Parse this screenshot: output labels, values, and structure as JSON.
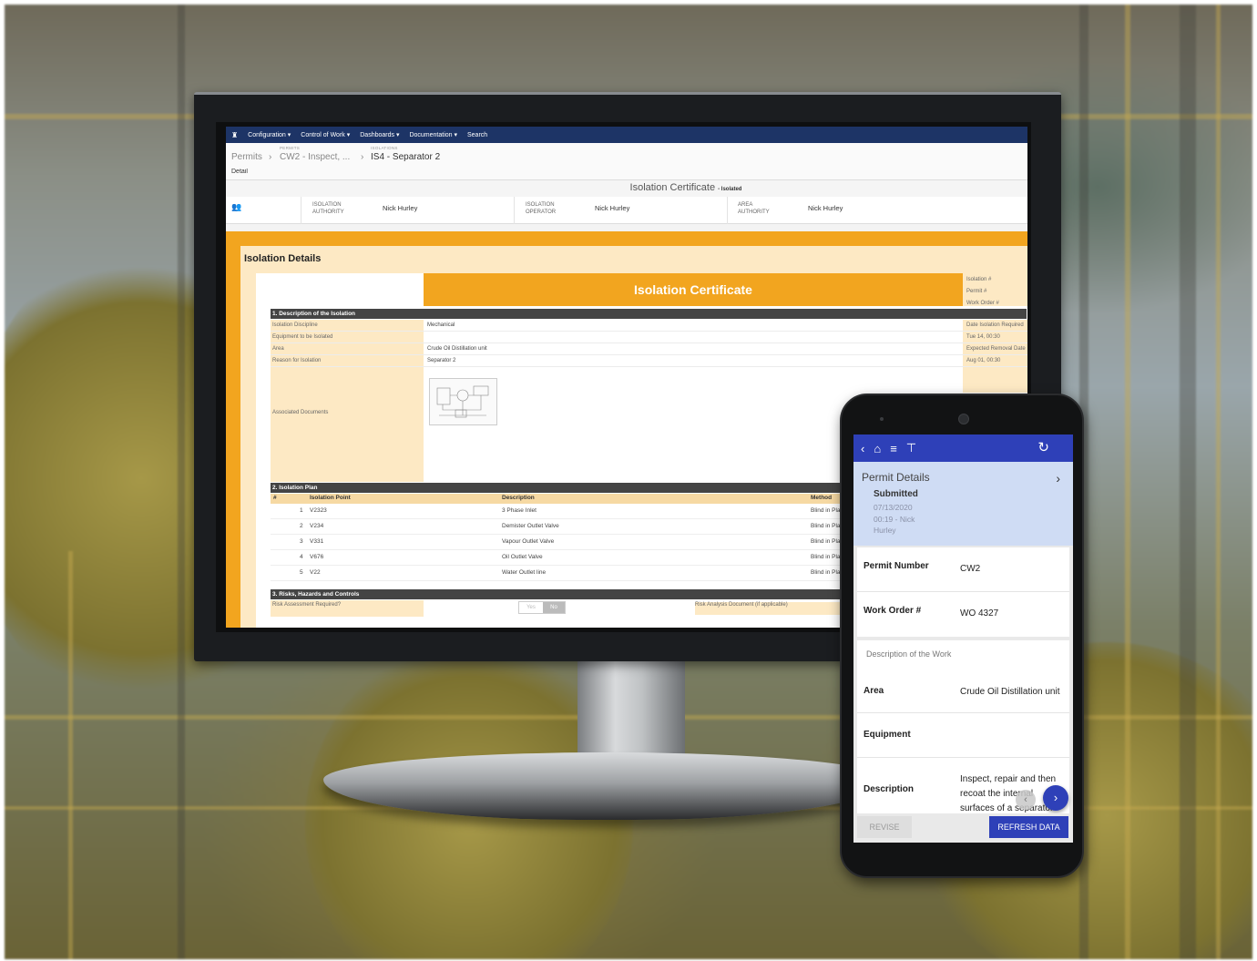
{
  "desktop": {
    "nav": {
      "home_icon": "home-icon",
      "items": [
        "Configuration ▾",
        "Control of Work ▾",
        "Dashboards ▾",
        "Documentation ▾",
        "Search"
      ]
    },
    "breadcrumb": {
      "root": "Permits",
      "permits_label": "PERMITS",
      "permit": "CW2 - Inspect, ...",
      "isolations_label": "ISOLATIONS",
      "current": "IS4 - Separator 2"
    },
    "tab": "Detail",
    "cert_header": {
      "title": "Isolation Certificate",
      "status": "- Isolated"
    },
    "authorities": [
      {
        "label_line1": "ISOLATION",
        "label_line2": "AUTHORITY",
        "value": "Nick Hurley"
      },
      {
        "label_line1": "ISOLATION",
        "label_line2": "OPERATOR",
        "value": "Nick Hurley"
      },
      {
        "label_line1": "AREA",
        "label_line2": "AUTHORITY",
        "value": "Nick Hurley"
      }
    ],
    "details_title": "Isolation Details",
    "banner": "Isolation Certificate",
    "side_labels": [
      "Isolation #",
      "Permit #",
      "Work Order #"
    ],
    "section1": {
      "title": "1. Description of the Isolation",
      "fields": [
        {
          "label": "Isolation Discipline",
          "value": "Mechanical"
        },
        {
          "label": "Equipment to be Isolated",
          "value": ""
        },
        {
          "label": "Area",
          "value": "Crude Oil Distillation unit"
        },
        {
          "label": "Reason for Isolation",
          "value": "Separator 2"
        }
      ],
      "docs_label": "Associated Documents",
      "right": [
        "Date Isolation Required",
        "Tue 14, 00:30",
        "Expected Removal Date",
        "Aug 01, 00:30"
      ]
    },
    "section2": {
      "title": "2. Isolation Plan",
      "columns": [
        "#",
        "Isolation Point",
        "Description",
        "Method"
      ],
      "rows": [
        {
          "n": "1",
          "point": "V2323",
          "desc": "3 Phase Inlet",
          "method": "Blind in Place"
        },
        {
          "n": "2",
          "point": "V234",
          "desc": "Demister Outlet Valve",
          "method": "Blind in Place"
        },
        {
          "n": "3",
          "point": "V331",
          "desc": "Vapour Outlet Valve",
          "method": "Blind in Place"
        },
        {
          "n": "4",
          "point": "V676",
          "desc": "Oil Outlet Valve",
          "method": "Blind in Place"
        },
        {
          "n": "5",
          "point": "V22",
          "desc": "Water Outlet line",
          "method": "Blind in Place"
        }
      ]
    },
    "section3": {
      "title": "3. Risks, Hazards and Controls",
      "risk_label": "Risk Assessment Required?",
      "yes": "Yes",
      "no": "No",
      "doc_label": "Risk Analysis Document (if applicable)"
    }
  },
  "mobile": {
    "appbar_icons": [
      "back-icon",
      "home-icon",
      "list-icon",
      "text-icon",
      "refresh-icon"
    ],
    "header": {
      "title": "Permit Details",
      "status": "Submitted",
      "meta": "07/13/2020 00:19 - Nick Hurley"
    },
    "fields_top": [
      {
        "key": "Permit Number",
        "value": "CW2"
      },
      {
        "key": "Work Order #",
        "value": "WO 4327"
      }
    ],
    "section": "Description of the Work",
    "fields_bottom": [
      {
        "key": "Area",
        "value": "Crude Oil Distillation unit"
      },
      {
        "key": "Equipment",
        "value": ""
      },
      {
        "key": "Description",
        "value": "Inspect, repair and then recoat the internal surfaces of a separator"
      }
    ],
    "revise_label": "REVISE",
    "refresh_label": "REFRESH DATA"
  }
}
